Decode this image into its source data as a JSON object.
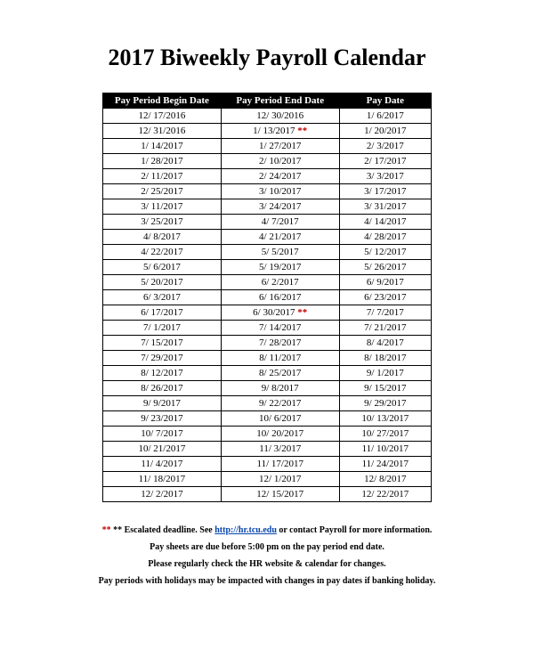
{
  "title": "2017 Biweekly Payroll Calendar",
  "columns": [
    "Pay Period Begin Date",
    "Pay Period End Date",
    "Pay Date"
  ],
  "rows": [
    {
      "begin": "12/ 17/2016",
      "end": "12/ 30/2016",
      "pay": "1/ 6/2017",
      "escalated": false
    },
    {
      "begin": "12/ 31/2016",
      "end": "1/ 13/2017",
      "pay": "1/ 20/2017",
      "escalated": true
    },
    {
      "begin": "1/ 14/2017",
      "end": "1/ 27/2017",
      "pay": "2/ 3/2017",
      "escalated": false
    },
    {
      "begin": "1/ 28/2017",
      "end": "2/ 10/2017",
      "pay": "2/ 17/2017",
      "escalated": false
    },
    {
      "begin": "2/ 11/2017",
      "end": "2/ 24/2017",
      "pay": "3/ 3/2017",
      "escalated": false
    },
    {
      "begin": "2/ 25/2017",
      "end": "3/ 10/2017",
      "pay": "3/ 17/2017",
      "escalated": false
    },
    {
      "begin": "3/ 11/2017",
      "end": "3/ 24/2017",
      "pay": "3/ 31/2017",
      "escalated": false
    },
    {
      "begin": "3/ 25/2017",
      "end": "4/ 7/2017",
      "pay": "4/ 14/2017",
      "escalated": false
    },
    {
      "begin": "4/ 8/2017",
      "end": "4/ 21/2017",
      "pay": "4/ 28/2017",
      "escalated": false
    },
    {
      "begin": "4/ 22/2017",
      "end": "5/ 5/2017",
      "pay": "5/ 12/2017",
      "escalated": false
    },
    {
      "begin": "5/ 6/2017",
      "end": "5/ 19/2017",
      "pay": "5/ 26/2017",
      "escalated": false
    },
    {
      "begin": "5/ 20/2017",
      "end": "6/ 2/2017",
      "pay": "6/ 9/2017",
      "escalated": false
    },
    {
      "begin": "6/ 3/2017",
      "end": "6/ 16/2017",
      "pay": "6/ 23/2017",
      "escalated": false
    },
    {
      "begin": "6/ 17/2017",
      "end": "6/ 30/2017",
      "pay": "7/ 7/2017",
      "escalated": true
    },
    {
      "begin": "7/ 1/2017",
      "end": "7/ 14/2017",
      "pay": "7/ 21/2017",
      "escalated": false
    },
    {
      "begin": "7/ 15/2017",
      "end": "7/ 28/2017",
      "pay": "8/ 4/2017",
      "escalated": false
    },
    {
      "begin": "7/ 29/2017",
      "end": "8/ 11/2017",
      "pay": "8/ 18/2017",
      "escalated": false
    },
    {
      "begin": "8/ 12/2017",
      "end": "8/ 25/2017",
      "pay": "9/ 1/2017",
      "escalated": false
    },
    {
      "begin": "8/ 26/2017",
      "end": "9/ 8/2017",
      "pay": "9/ 15/2017",
      "escalated": false
    },
    {
      "begin": "9/ 9/2017",
      "end": "9/ 22/2017",
      "pay": "9/ 29/2017",
      "escalated": false
    },
    {
      "begin": "9/ 23/2017",
      "end": "10/ 6/2017",
      "pay": "10/ 13/2017",
      "escalated": false
    },
    {
      "begin": "10/ 7/2017",
      "end": "10/ 20/2017",
      "pay": "10/ 27/2017",
      "escalated": false
    },
    {
      "begin": "10/ 21/2017",
      "end": "11/ 3/2017",
      "pay": "11/ 10/2017",
      "escalated": false
    },
    {
      "begin": "11/ 4/2017",
      "end": "11/ 17/2017",
      "pay": "11/ 24/2017",
      "escalated": false
    },
    {
      "begin": "11/ 18/2017",
      "end": "12/ 1/2017",
      "pay": "12/ 8/2017",
      "escalated": false
    },
    {
      "begin": "12/ 2/2017",
      "end": "12/ 15/2017",
      "pay": "12/ 22/2017",
      "escalated": false
    }
  ],
  "escalated_marker": "**",
  "footnotes": {
    "line1_prefix": "** Escalated deadline. See ",
    "line1_link_text": "http://hr.tcu.edu",
    "line1_suffix": " or contact Payroll for more information.",
    "line2": "Pay sheets are due before 5:00 pm on the pay period end date.",
    "line3": "Please regularly check the HR website & calendar for changes.",
    "line4": "Pay periods with holidays may be impacted with changes in pay dates if banking holiday."
  }
}
